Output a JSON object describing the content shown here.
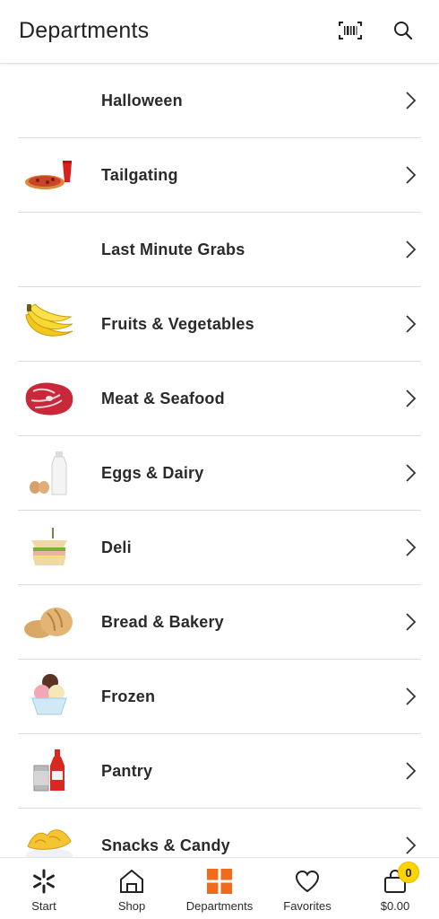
{
  "header": {
    "title": "Departments",
    "barcode_icon": "barcode-scanner-icon",
    "search_icon": "search-icon"
  },
  "departments": [
    {
      "label": "Halloween",
      "icon": "none"
    },
    {
      "label": "Tailgating",
      "icon": "pizza-icon"
    },
    {
      "label": "Last Minute Grabs",
      "icon": "none"
    },
    {
      "label": "Fruits & Vegetables",
      "icon": "banana-icon"
    },
    {
      "label": "Meat & Seafood",
      "icon": "meat-icon"
    },
    {
      "label": "Eggs & Dairy",
      "icon": "milk-eggs-icon"
    },
    {
      "label": "Deli",
      "icon": "sandwich-icon"
    },
    {
      "label": "Bread & Bakery",
      "icon": "bread-icon"
    },
    {
      "label": "Frozen",
      "icon": "ice-cream-icon"
    },
    {
      "label": "Pantry",
      "icon": "ketchup-can-icon"
    },
    {
      "label": "Snacks & Candy",
      "icon": "chips-icon"
    }
  ],
  "bottom_nav": {
    "items": [
      {
        "label": "Start",
        "icon": "spark-icon"
      },
      {
        "label": "Shop",
        "icon": "store-icon"
      },
      {
        "label": "Departments",
        "icon": "grid-icon",
        "active": true
      },
      {
        "label": "Favorites",
        "icon": "heart-icon"
      },
      {
        "label": "$0.00",
        "icon": "cart-bag-icon"
      }
    ],
    "cart_count": "0"
  },
  "colors": {
    "accent_orange": "#f26b1d",
    "badge_yellow": "#ffd200",
    "divider": "#dcdcdc"
  }
}
